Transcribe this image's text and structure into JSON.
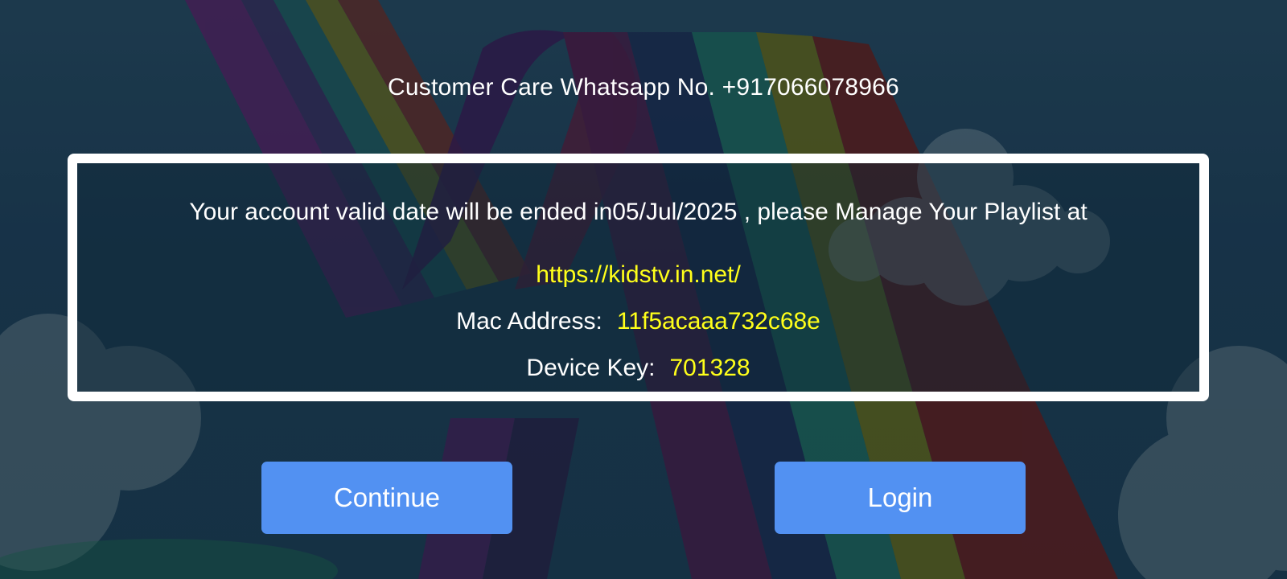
{
  "customer_care": {
    "text": "Customer Care Whatsapp No. +917066078966"
  },
  "account_box": {
    "message": "Your account valid date will be ended in05/Jul/2025 , please Manage Your Playlist at",
    "url": "https://kidstv.in.net/",
    "mac_label": "Mac Address:",
    "mac_value": "11f5acaaa732c68e",
    "device_key_label": "Device Key:",
    "device_key_value": "701328"
  },
  "buttons": {
    "continue_label": "Continue",
    "login_label": "Login"
  },
  "colors": {
    "accent_button": "#5291f2",
    "highlight_text": "#ffff1a",
    "box_border": "#ffffff"
  }
}
